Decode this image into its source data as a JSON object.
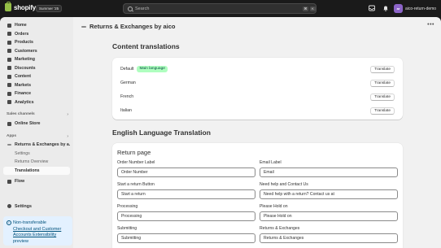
{
  "topbar": {
    "logo_text": "shopify",
    "edition": "Summer '25",
    "search_placeholder": "Search",
    "shortcut_key1": "⌘",
    "shortcut_key2": "K",
    "store_initials": "ar",
    "store_name": "aico-return-demo"
  },
  "sidebar": {
    "items": [
      {
        "label": "Home",
        "icon": "home-icon"
      },
      {
        "label": "Orders",
        "icon": "orders-icon"
      },
      {
        "label": "Products",
        "icon": "products-icon"
      },
      {
        "label": "Customers",
        "icon": "customers-icon"
      },
      {
        "label": "Marketing",
        "icon": "marketing-icon"
      },
      {
        "label": "Discounts",
        "icon": "discounts-icon"
      },
      {
        "label": "Content",
        "icon": "content-icon"
      },
      {
        "label": "Markets",
        "icon": "markets-icon"
      },
      {
        "label": "Finance",
        "icon": "finance-icon"
      },
      {
        "label": "Analytics",
        "icon": "analytics-icon"
      }
    ],
    "sales_channels_label": "Sales channels",
    "online_store": "Online Store",
    "apps_label": "Apps",
    "app_name": "Returns & Exchanges by a...",
    "app_subitems": [
      "Settings",
      "Returns Overview",
      "Translations"
    ],
    "flow": "Flow",
    "settings": "Settings",
    "promo": {
      "line1": "Non-transferable",
      "link": "Checkout and Customer Accounts Extensibility",
      "line3": "preview"
    }
  },
  "main": {
    "title": "Returns & Exchanges by aico",
    "content_translations_heading": "Content translations",
    "languages": [
      {
        "name": "Default",
        "badge": "Main language",
        "button": "Translate"
      },
      {
        "name": "German",
        "badge": "",
        "button": "Translate"
      },
      {
        "name": "French",
        "badge": "",
        "button": "Translate"
      },
      {
        "name": "Italian",
        "badge": "",
        "button": "Translate"
      }
    ],
    "english_heading": "English Language Translation",
    "return_page_title": "Return page",
    "fields": [
      {
        "label": "Order Number Label",
        "value": "Order Number"
      },
      {
        "label": "Email Label",
        "value": "Email"
      },
      {
        "label": "Start a return Button",
        "value": "Start a return"
      },
      {
        "label": "Need help and Contact Us",
        "value": "Need help with a return? Contact us at"
      },
      {
        "label": "Processing",
        "value": "Processing"
      },
      {
        "label": "Please Hold on",
        "value": "Please Hold on"
      },
      {
        "label": "Submitting",
        "value": "Submitting"
      },
      {
        "label": "Returns & Exchanges",
        "value": "Returns & Exchanges"
      }
    ]
  },
  "colors": {
    "topbar_bg": "#1a1a1a",
    "sidebar_bg": "#ebebeb",
    "main_bg": "#f1f1f1",
    "badge_bg": "#affebf",
    "promo_bg": "#e3f1ff",
    "brand_green": "#95bf47"
  }
}
